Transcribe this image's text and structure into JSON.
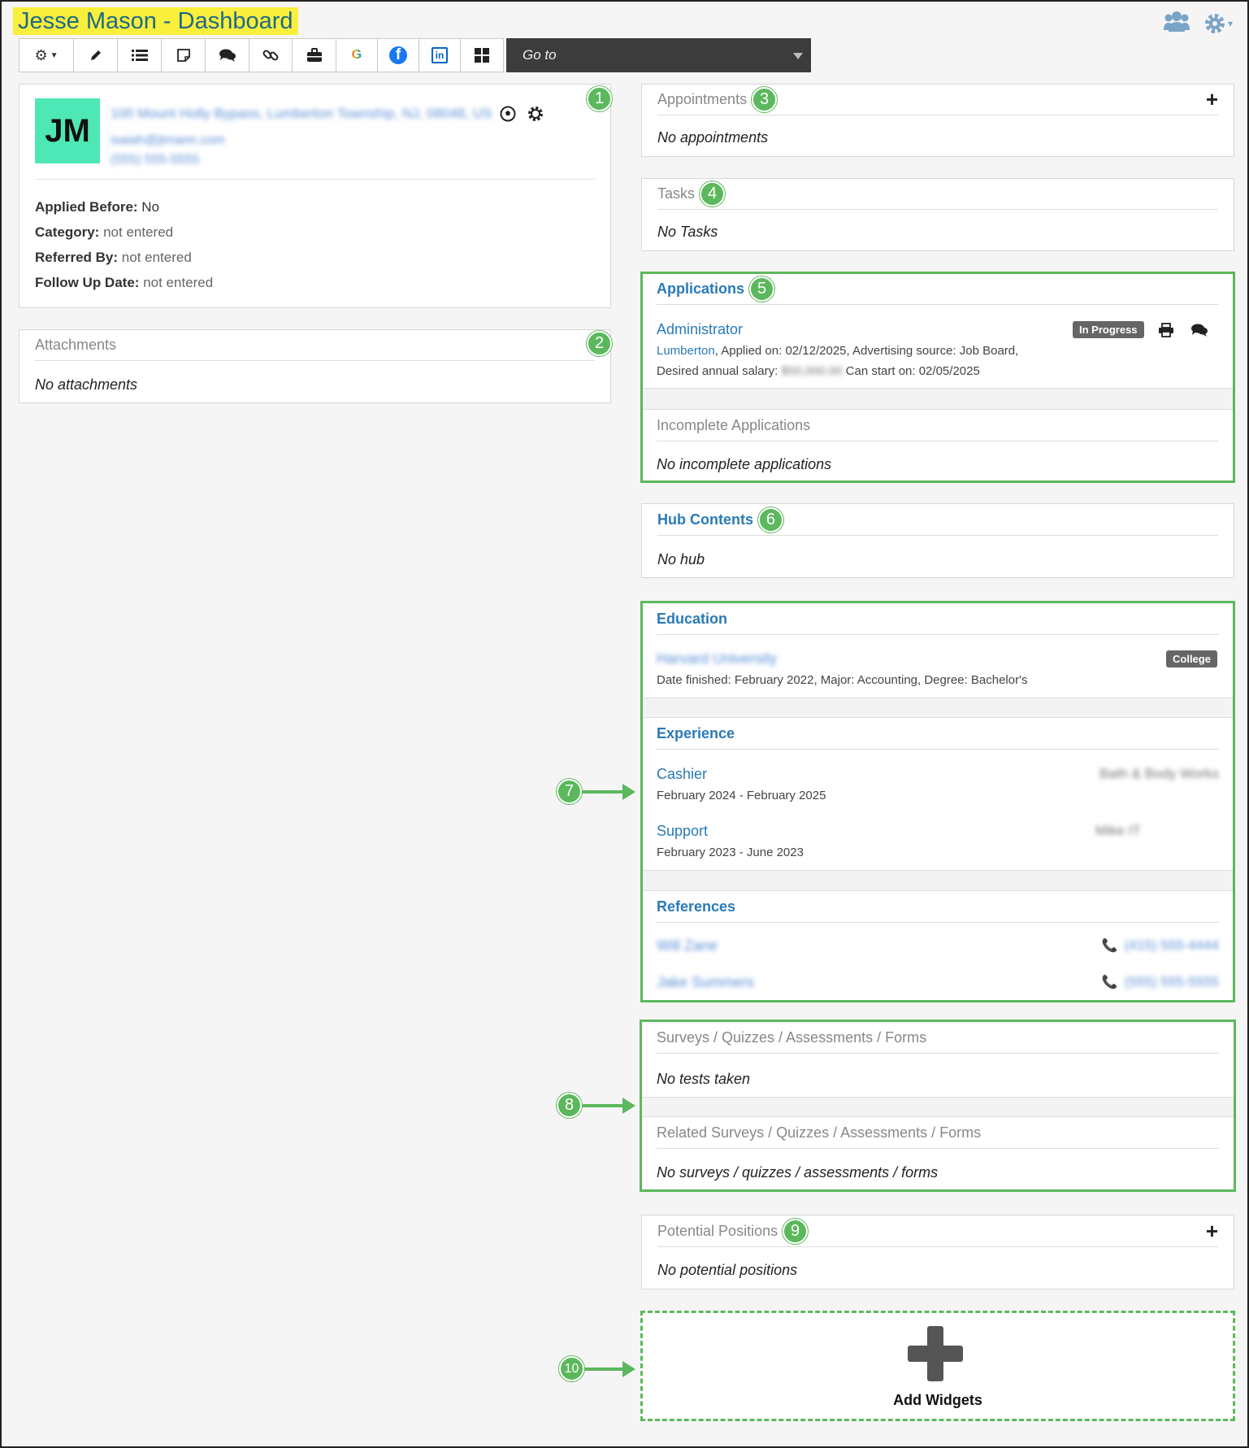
{
  "header": {
    "title": "Jesse Mason - Dashboard",
    "goto_placeholder": "Go to"
  },
  "toolbar": {
    "items": [
      {
        "name": "actions",
        "glyph": "⚙"
      },
      {
        "name": "edit",
        "glyph": "✎"
      },
      {
        "name": "list",
        "glyph": "≣"
      },
      {
        "name": "note",
        "glyph": "▢"
      },
      {
        "name": "chat",
        "glyph": "💬"
      },
      {
        "name": "link",
        "glyph": "🔗"
      },
      {
        "name": "briefcase",
        "glyph": "💼"
      },
      {
        "name": "google",
        "glyph": "G"
      },
      {
        "name": "facebook",
        "glyph": "f"
      },
      {
        "name": "linkedin",
        "glyph": "in"
      },
      {
        "name": "grid",
        "glyph": "▦"
      }
    ]
  },
  "profile": {
    "initials": "JM",
    "address": "100 Mount Holly Bypass, Lumberton Township, NJ, 08048, US",
    "email": "isaiah@jtmann.com",
    "phone": "(555) 555-5555",
    "marker": "1",
    "fields": [
      {
        "label": "Applied Before:",
        "value": "No"
      },
      {
        "label": "Category:",
        "value": "not entered"
      },
      {
        "label": "Referred By:",
        "value": "not entered"
      },
      {
        "label": "Follow Up Date:",
        "value": "not entered"
      }
    ]
  },
  "attachments": {
    "title": "Attachments",
    "marker": "2",
    "empty": "No attachments"
  },
  "appointments": {
    "title": "Appointments",
    "marker": "3",
    "empty": "No appointments",
    "add": "+"
  },
  "tasks": {
    "title": "Tasks",
    "marker": "4",
    "empty": "No Tasks"
  },
  "applications": {
    "title": "Applications",
    "marker": "5",
    "position": "Administrator",
    "location": "Lumberton",
    "details": ", Applied on: 02/12/2025, Advertising source: Job Board,",
    "salary_label": "Desired annual salary:",
    "salary_value": "$50,000.00",
    "start": "Can start on: 02/05/2025",
    "status": "In Progress",
    "incomplete_title": "Incomplete Applications",
    "incomplete_empty": "No incomplete applications"
  },
  "hub": {
    "title": "Hub Contents",
    "marker": "6",
    "empty": "No hub"
  },
  "education": {
    "title": "Education",
    "school": "Harvard University",
    "badge": "College",
    "details": "Date finished: February 2022, Major: Accounting, Degree: Bachelor's"
  },
  "experience": {
    "title": "Experience",
    "jobs": [
      {
        "title": "Cashier",
        "dates": "February 2024 - February 2025",
        "company": "Bath & Body Works"
      },
      {
        "title": "Support",
        "dates": "February 2023 - June 2023",
        "company": "Mike IT"
      }
    ]
  },
  "references": {
    "title": "References",
    "people": [
      {
        "name": "Will Zane",
        "phone": "(415) 555-4444"
      },
      {
        "name": "Jake Summers",
        "phone": "(555) 555-5555"
      }
    ]
  },
  "surveys": {
    "title": "Surveys / Quizzes / Assessments / Forms",
    "empty": "No tests taken",
    "related_title": "Related Surveys / Quizzes / Assessments / Forms",
    "related_empty": "No surveys / quizzes / assessments / forms"
  },
  "potential": {
    "title": "Potential Positions",
    "marker": "9",
    "empty": "No potential positions",
    "add": "+"
  },
  "widgets": {
    "label": "Add Widgets",
    "marker": "10"
  },
  "markers": {
    "m7": "7",
    "m8": "8"
  },
  "colors": {
    "accent_green": "#5cb85c",
    "link_blue": "#2a7ab8",
    "title_highlight": "#f9ef3c",
    "avatar": "#4de8b5"
  }
}
